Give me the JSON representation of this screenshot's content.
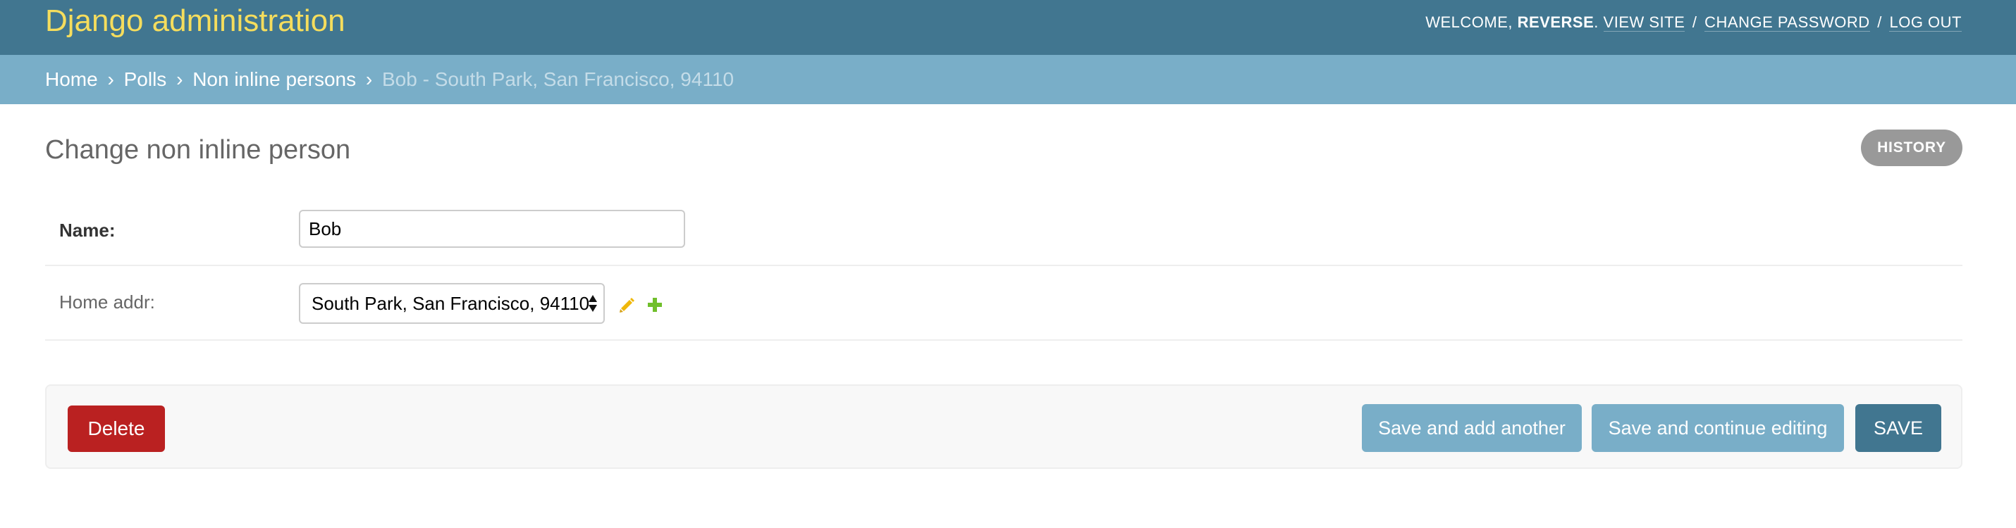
{
  "header": {
    "site_name": "Django administration",
    "welcome_prefix": "WELCOME,",
    "username": "REVERSE",
    "period": ".",
    "view_site_label": "VIEW SITE",
    "change_password_label": "CHANGE PASSWORD",
    "logout_label": "LOG OUT",
    "separator": "/"
  },
  "breadcrumbs": {
    "items": [
      {
        "label": "Home"
      },
      {
        "label": "Polls"
      },
      {
        "label": "Non inline persons"
      }
    ],
    "separator": "›",
    "current": "Bob - South Park, San Francisco, 94110"
  },
  "content": {
    "title": "Change non inline person",
    "history_label": "HISTORY"
  },
  "form": {
    "name": {
      "label": "Name:",
      "value": "Bob"
    },
    "home_addr": {
      "label": "Home addr:",
      "selected": "South Park, San Francisco, 94110"
    }
  },
  "submit_row": {
    "delete_label": "Delete",
    "save_add_another_label": "Save and add another",
    "save_continue_label": "Save and continue editing",
    "save_label": "SAVE"
  },
  "colors": {
    "header_bg": "#417690",
    "breadcrumbs_bg": "#79aec8",
    "brand_yellow": "#f5dd5d",
    "delete_red": "#ba2121",
    "secondary_button": "#79aec8",
    "primary_button": "#417690",
    "history_gray": "#999999",
    "edit_icon": "#efb80b",
    "add_icon": "#70bf2b"
  },
  "icons": {
    "edit_related": "pencil-icon",
    "add_related": "plus-icon",
    "select_arrows": "updown-arrows-icon"
  }
}
